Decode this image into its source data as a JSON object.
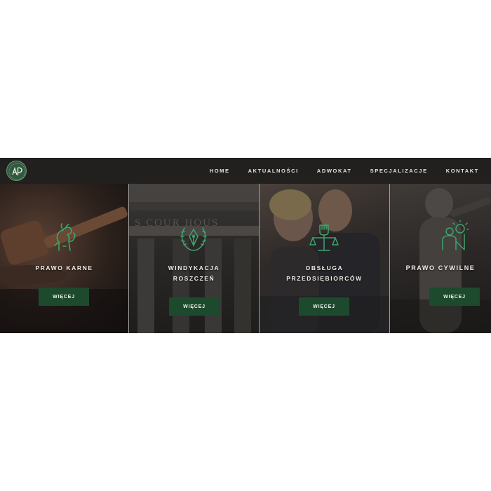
{
  "nav": {
    "items": [
      {
        "label": "HOME"
      },
      {
        "label": "AKTUALNOŚCI"
      },
      {
        "label": "ADWOKAT"
      },
      {
        "label": "SPECJALIZACJE"
      },
      {
        "label": "KONTAKT"
      }
    ]
  },
  "background_text": "S COUR HOUS",
  "panels": [
    {
      "title": [
        "PRAWO KARNE"
      ],
      "button": "WIĘCEJ",
      "icon": "lion-icon"
    },
    {
      "title": [
        "WINDYKACJA",
        "ROSZCZEŃ"
      ],
      "button": "WIĘCEJ",
      "icon": "pen-laurel-icon"
    },
    {
      "title": [
        "OBSŁUGA",
        "PRZEDSIĘBIORCÓW"
      ],
      "button": "WIĘCEJ",
      "icon": "scales-fist-icon"
    },
    {
      "title": [
        "PRAWO CYWILNE"
      ],
      "button": "WIĘCEJ",
      "icon": "person-idea-icon"
    }
  ],
  "colors": {
    "accent": "#1d4a2c",
    "icon_green": "#3fa36b",
    "navbar": "#221f1f"
  }
}
